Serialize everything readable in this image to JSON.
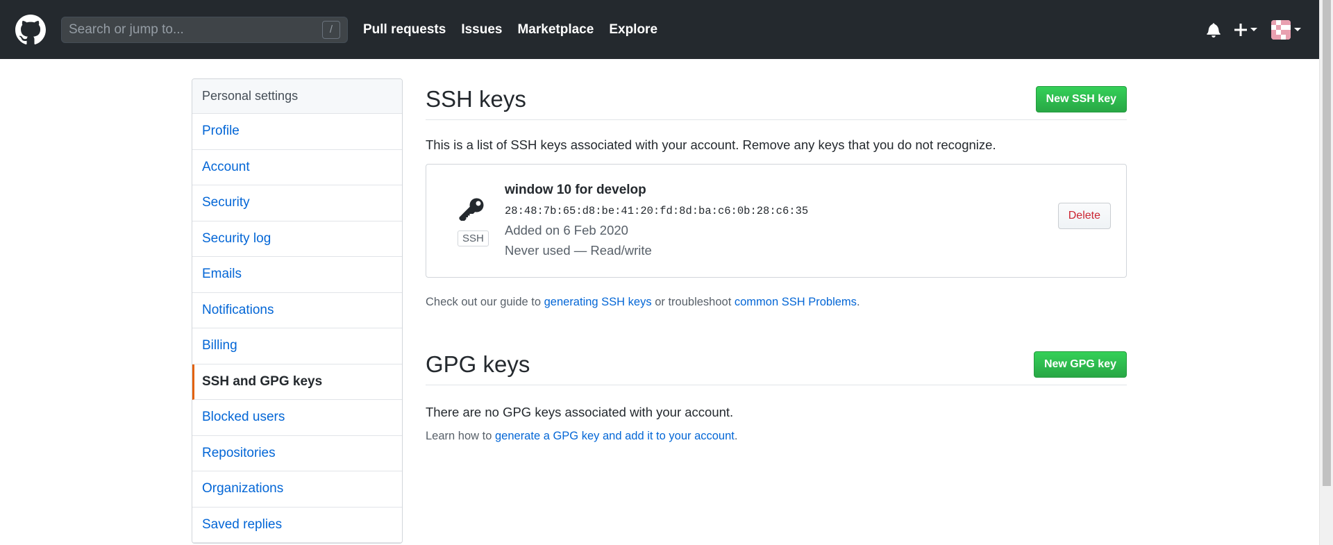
{
  "header": {
    "search_placeholder": "Search or jump to...",
    "search_shortcut": "/",
    "nav": [
      "Pull requests",
      "Issues",
      "Marketplace",
      "Explore"
    ]
  },
  "sidebar": {
    "heading": "Personal settings",
    "items": [
      {
        "label": "Profile"
      },
      {
        "label": "Account"
      },
      {
        "label": "Security"
      },
      {
        "label": "Security log"
      },
      {
        "label": "Emails"
      },
      {
        "label": "Notifications"
      },
      {
        "label": "Billing"
      },
      {
        "label": "SSH and GPG keys",
        "active": true
      },
      {
        "label": "Blocked users"
      },
      {
        "label": "Repositories"
      },
      {
        "label": "Organizations"
      },
      {
        "label": "Saved replies"
      }
    ]
  },
  "ssh": {
    "title": "SSH keys",
    "new_button": "New SSH key",
    "description": "This is a list of SSH keys associated with your account. Remove any keys that you do not recognize.",
    "key": {
      "badge": "SSH",
      "name": "window 10 for develop",
      "fingerprint": "28:48:7b:65:d8:be:41:20:fd:8d:ba:c6:0b:28:c6:35",
      "added": "Added on 6 Feb 2020",
      "usage": "Never used — Read/write",
      "delete_button": "Delete"
    },
    "note_prefix": "Check out our guide to ",
    "note_link1": "generating SSH keys",
    "note_middle": " or troubleshoot ",
    "note_link2": "common SSH Problems",
    "note_suffix": "."
  },
  "gpg": {
    "title": "GPG keys",
    "new_button": "New GPG key",
    "none_text": "There are no GPG keys associated with your account.",
    "learn_prefix": "Learn how to ",
    "learn_link": "generate a GPG key and add it to your account",
    "learn_suffix": "."
  },
  "colors": {
    "header_bg": "#24292e",
    "link": "#0366d6",
    "green": "#28a745",
    "active_border": "#e36209",
    "danger": "#cb2431"
  }
}
